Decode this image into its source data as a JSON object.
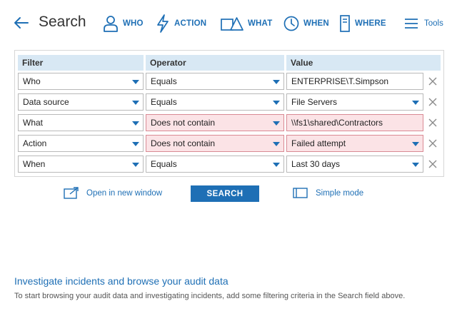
{
  "header": {
    "title": "Search",
    "nav": [
      {
        "label": "WHO",
        "icon": "user-icon"
      },
      {
        "label": "ACTION",
        "icon": "lightning-icon"
      },
      {
        "label": "WHAT",
        "icon": "shapes-icon"
      },
      {
        "label": "WHEN",
        "icon": "clock-icon"
      },
      {
        "label": "WHERE",
        "icon": "server-icon"
      }
    ],
    "tools_label": "Tools"
  },
  "filter_table": {
    "columns": [
      "Filter",
      "Operator",
      "Value"
    ],
    "rows": [
      {
        "filter": "Who",
        "operator": "Equals",
        "value": "ENTERPRISE\\T.Simpson",
        "value_dropdown": false,
        "highlighted": false
      },
      {
        "filter": "Data source",
        "operator": "Equals",
        "value": "File Servers",
        "value_dropdown": true,
        "highlighted": false
      },
      {
        "filter": "What",
        "operator": "Does not contain",
        "value": "\\\\fs1\\shared\\Contractors",
        "value_dropdown": false,
        "highlighted": true
      },
      {
        "filter": "Action",
        "operator": "Does not contain",
        "value": "Failed attempt",
        "value_dropdown": true,
        "highlighted": true
      },
      {
        "filter": "When",
        "operator": "Equals",
        "value": "Last 30 days",
        "value_dropdown": true,
        "highlighted": false
      }
    ]
  },
  "actions": {
    "open_new_window": "Open in new window",
    "search_button": "SEARCH",
    "simple_mode": "Simple mode"
  },
  "info": {
    "title": "Investigate incidents and browse your audit data",
    "text": "To start browsing your audit data and investigating incidents, add some filtering criteria in the Search field above."
  },
  "colors": {
    "accent": "#1e6fb5",
    "header_bg": "#d8e8f4",
    "highlight_bg": "#fbe3e6",
    "highlight_border": "#d98a94"
  }
}
